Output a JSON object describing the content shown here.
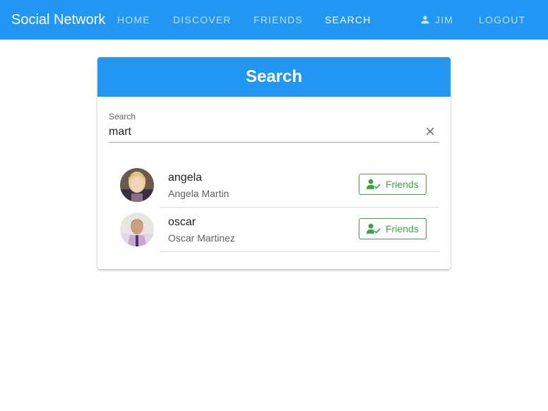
{
  "topbar": {
    "brand": "Social Network",
    "nav": {
      "home": "HOME",
      "discover": "DISCOVER",
      "friends": "FRIENDS",
      "search": "SEARCH",
      "user": "JIM",
      "logout": "LOGOUT"
    }
  },
  "search_card": {
    "title": "Search",
    "field_label": "Search",
    "field_value": "mart",
    "results": [
      {
        "username": "angela",
        "full_name": "Angela Martin",
        "action": "Friends"
      },
      {
        "username": "oscar",
        "full_name": "Oscar Martinez",
        "action": "Friends"
      }
    ]
  },
  "icons": {
    "user": "account-icon",
    "clear": "close-icon",
    "friends": "person-check-icon"
  },
  "colors": {
    "primary": "#2196f3",
    "success": "#43a047"
  }
}
